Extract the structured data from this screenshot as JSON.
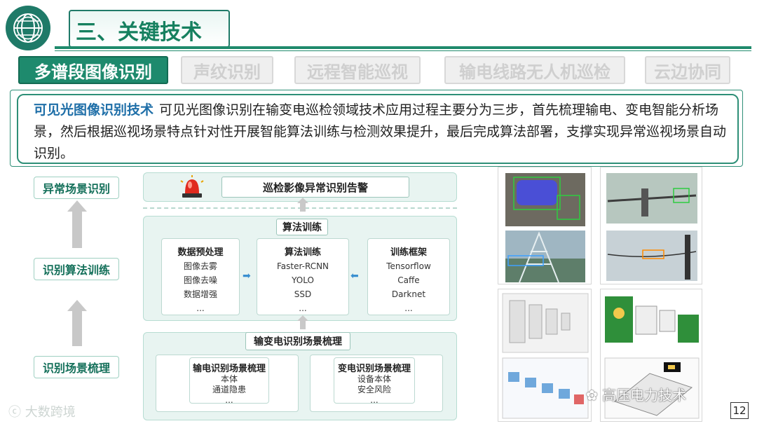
{
  "header": {
    "title": "三、关键技术"
  },
  "tabs": [
    {
      "label": "多谱段图像识别",
      "active": true
    },
    {
      "label": "声纹识别",
      "active": false
    },
    {
      "label": "远程智能巡视",
      "active": false
    },
    {
      "label": "输电线路无人机巡检",
      "active": false
    },
    {
      "label": "云边协同",
      "active": false
    }
  ],
  "description": {
    "keyword": "可见光图像识别技术",
    "text": "可见光图像识别在输变电巡检领域技术应用过程主要分为三步，首先梳理输电、变电智能分析场景，然后根据巡视场景特点针对性开展智能算法训练与检测效果提升，最后完成算法部署，支撑实现异常巡视场景自动识别。"
  },
  "stages": [
    "异常场景识别",
    "识别算法训练",
    "识别场景梳理"
  ],
  "alarm": {
    "label": "巡检影像异常识别告警"
  },
  "training": {
    "title": "算法训练",
    "cards": [
      {
        "title": "数据预处理",
        "items": [
          "图像去雾",
          "图像去噪",
          "数据增强",
          "..."
        ]
      },
      {
        "title": "算法训练",
        "items": [
          "Faster-RCNN",
          "YOLO",
          "SSD",
          "..."
        ]
      },
      {
        "title": "训练框架",
        "items": [
          "Tensorflow",
          "Caffe",
          "Darknet",
          "..."
        ]
      }
    ]
  },
  "scenes": {
    "title": "输变电识别场景梳理",
    "cards": [
      {
        "title": "输电识别场景梳理",
        "items": [
          "本体",
          "通道隐患",
          "..."
        ]
      },
      {
        "title": "变电识别场景梳理",
        "items": [
          "设备本体",
          "安全风险",
          "..."
        ]
      }
    ]
  },
  "footer": {
    "left_watermark": "大数跨境",
    "right_watermark": "高压电力技术",
    "page_number": "12"
  },
  "colors": {
    "accent": "#1e8a6d",
    "tab_inactive": "#efefef",
    "panel_bg": "#e8f4f1"
  }
}
